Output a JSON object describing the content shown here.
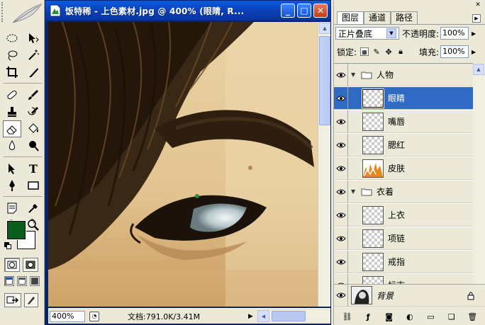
{
  "document": {
    "title": "饭特稀 - 上色素材.jpg @ 400% (眼睛, R...",
    "zoom": "400%",
    "doc_info": "文档:791.0K/3.41M",
    "window_buttons": {
      "minimize": "_",
      "maximize": "□",
      "close": "✕"
    }
  },
  "layers_panel": {
    "tabs": [
      {
        "label": "图层",
        "active": true
      },
      {
        "label": "通道",
        "active": false
      },
      {
        "label": "路径",
        "active": false
      }
    ],
    "blend_mode": "正片叠底",
    "opacity_label": "不透明度:",
    "opacity_value": "100%",
    "lock_label": "锁定:",
    "fill_label": "填充:",
    "fill_value": "100%",
    "groups": [
      {
        "name": "人物",
        "layers": [
          "眼睛",
          "嘴唇",
          "腮红",
          "皮肤"
        ]
      },
      {
        "name": "衣着",
        "layers": [
          "上衣",
          "项链",
          "戒指",
          "标志"
        ]
      }
    ],
    "selected_layer": "眼睛",
    "background_layer": "背景"
  },
  "toolbox": {
    "foreground_color": "#0b5d1e",
    "background_color": "#ffffff",
    "text_tool_glyph": "T"
  },
  "colors": {
    "title_bar": "#0a49c9",
    "selection": "#316ac5",
    "panel": "#ece9d8"
  }
}
